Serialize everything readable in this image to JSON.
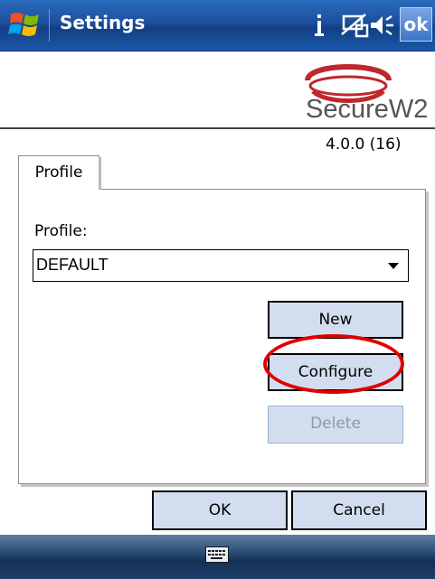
{
  "titlebar": {
    "title": "Settings",
    "ok_label": "ok",
    "icons": [
      "windows-start-icon",
      "signal-icon",
      "network-icon",
      "volume-icon"
    ]
  },
  "logo": {
    "brand": "SecureW2",
    "version": "4.0.0 (16)"
  },
  "tab": {
    "label": "Profile"
  },
  "form": {
    "profile_label": "Profile:",
    "profile_value": "DEFAULT",
    "new_label": "New",
    "configure_label": "Configure",
    "delete_label": "Delete"
  },
  "footer": {
    "ok_label": "OK",
    "cancel_label": "Cancel"
  },
  "menubar": {
    "icon": "keyboard-icon"
  },
  "colors": {
    "titlebar": "#1c4f9c",
    "button_fill": "#d2deef",
    "highlight": "#e00000",
    "logo_ring": "#c0262d"
  }
}
